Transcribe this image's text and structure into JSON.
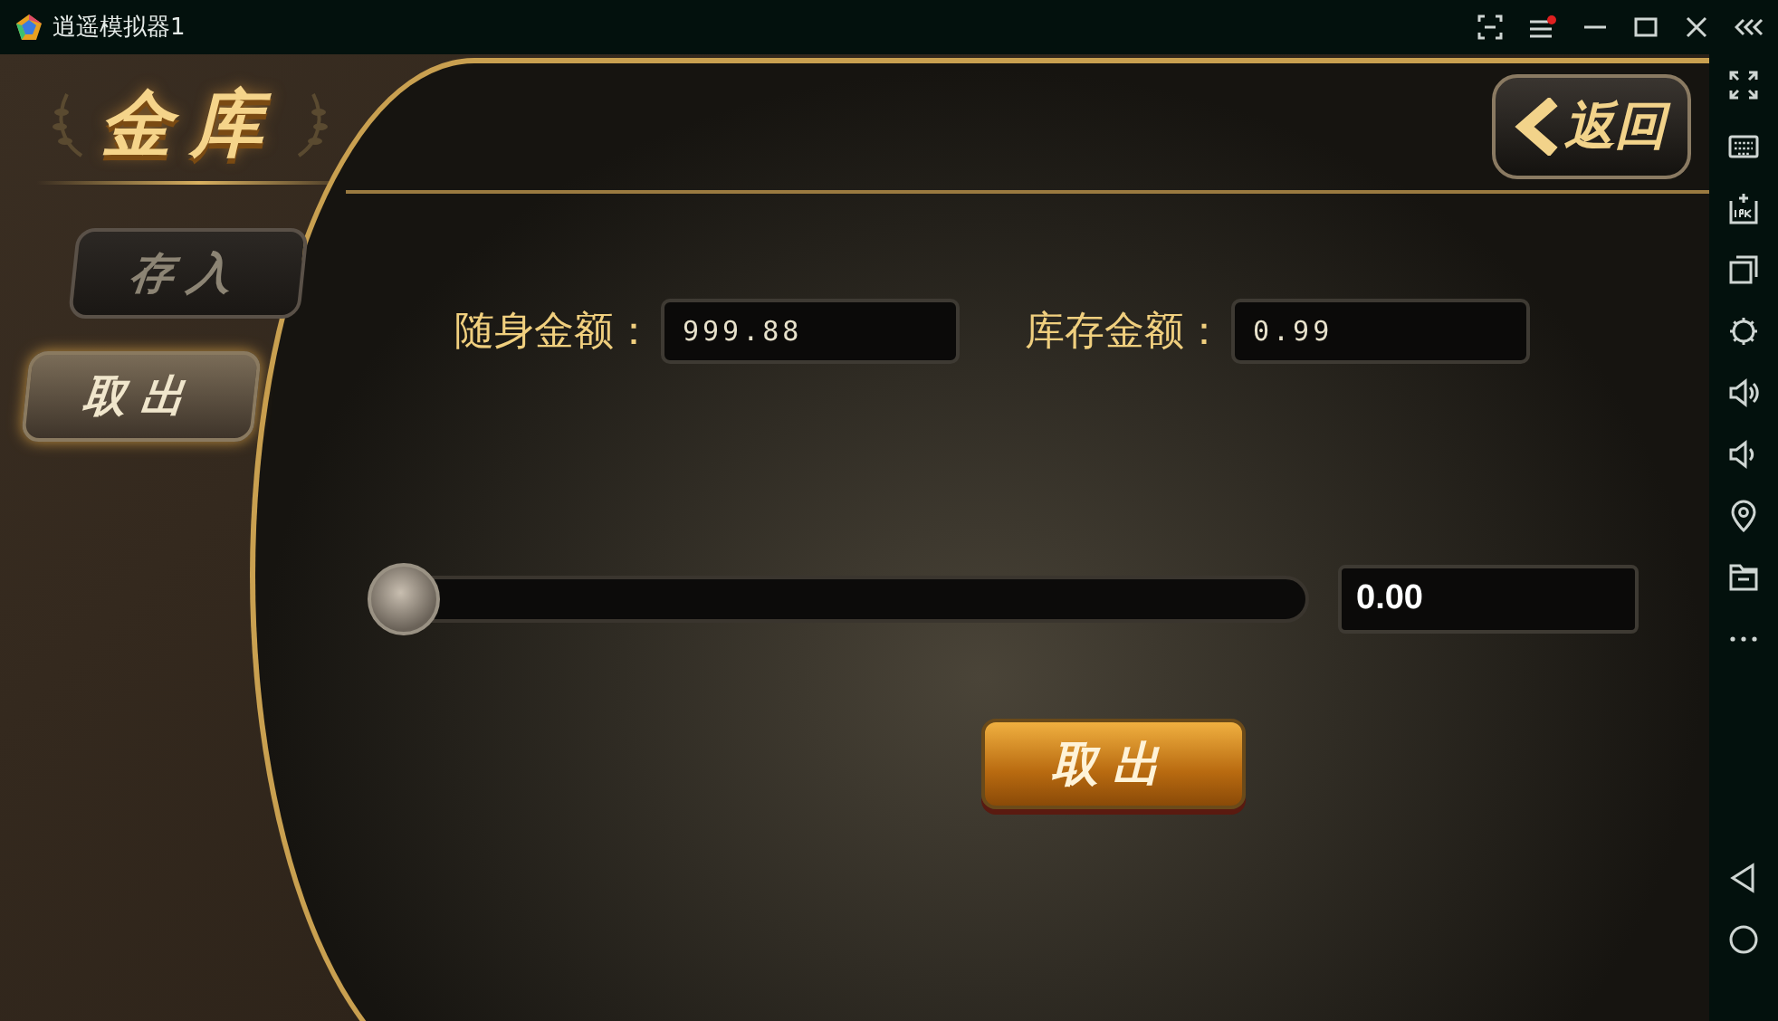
{
  "window": {
    "title": "逍遥模拟器1"
  },
  "vault": {
    "title": "金库",
    "tabs": [
      {
        "label": "存入",
        "selected": false
      },
      {
        "label": "取出",
        "selected": true
      }
    ],
    "back_button": "返回",
    "fields": [
      {
        "label": "随身金额：",
        "value": "999.88"
      },
      {
        "label": "库存金额：",
        "value": "0.99"
      }
    ],
    "slider": {
      "level": 0
    },
    "amount": "0.00",
    "action_button": "取出"
  }
}
